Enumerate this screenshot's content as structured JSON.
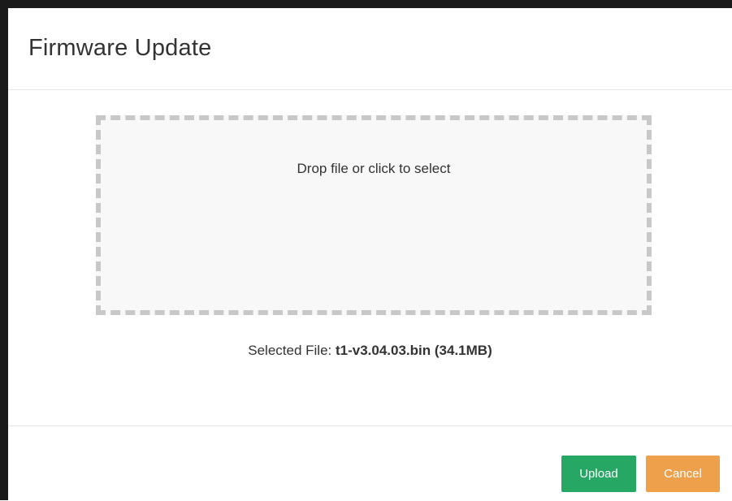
{
  "dialog": {
    "title": "Firmware Update"
  },
  "dropzone": {
    "prompt": "Drop file or click to select"
  },
  "selected_file": {
    "label": "Selected File:",
    "name": "t1-v3.04.03.bin",
    "size": "(34.1MB)"
  },
  "footer": {
    "upload_label": "Upload",
    "cancel_label": "Cancel"
  },
  "colors": {
    "upload_button": "#27a764",
    "cancel_button": "#efa04a",
    "dropzone_border": "#c8c8c8"
  }
}
